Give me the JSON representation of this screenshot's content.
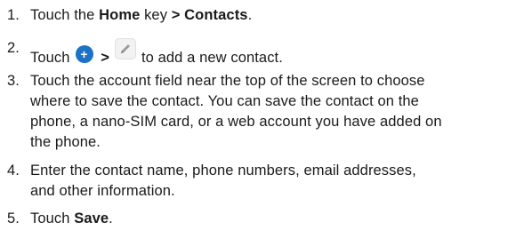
{
  "steps": [
    {
      "num": "1.",
      "parts": {
        "a": "Touch the ",
        "b": "Home",
        "c": " key ",
        "d": "> Contacts",
        "e": "."
      }
    },
    {
      "num": "2.",
      "parts": {
        "a": "Touch",
        "sep": ">",
        "c": "to add a new contact."
      },
      "icons": [
        "add-contact-icon",
        "edit-pencil-icon"
      ],
      "add_icon_glyph": "+"
    },
    {
      "num": "3.",
      "lines": [
        "Touch the account field near the top of the screen to choose",
        "where to save the contact. You can save the contact on the",
        "phone, a nano-SIM card, or a web account you have added on",
        "the phone."
      ]
    },
    {
      "num": "4.",
      "lines": [
        "Enter the contact name, phone numbers, email addresses,",
        "and other information."
      ]
    },
    {
      "num": "5.",
      "parts": {
        "a": "Touch ",
        "b": "Save",
        "c": "."
      }
    }
  ],
  "colors": {
    "text": "#1a1a1a",
    "add_icon": "#1c72c4",
    "edit_icon_bg": "#f2f2f2"
  }
}
